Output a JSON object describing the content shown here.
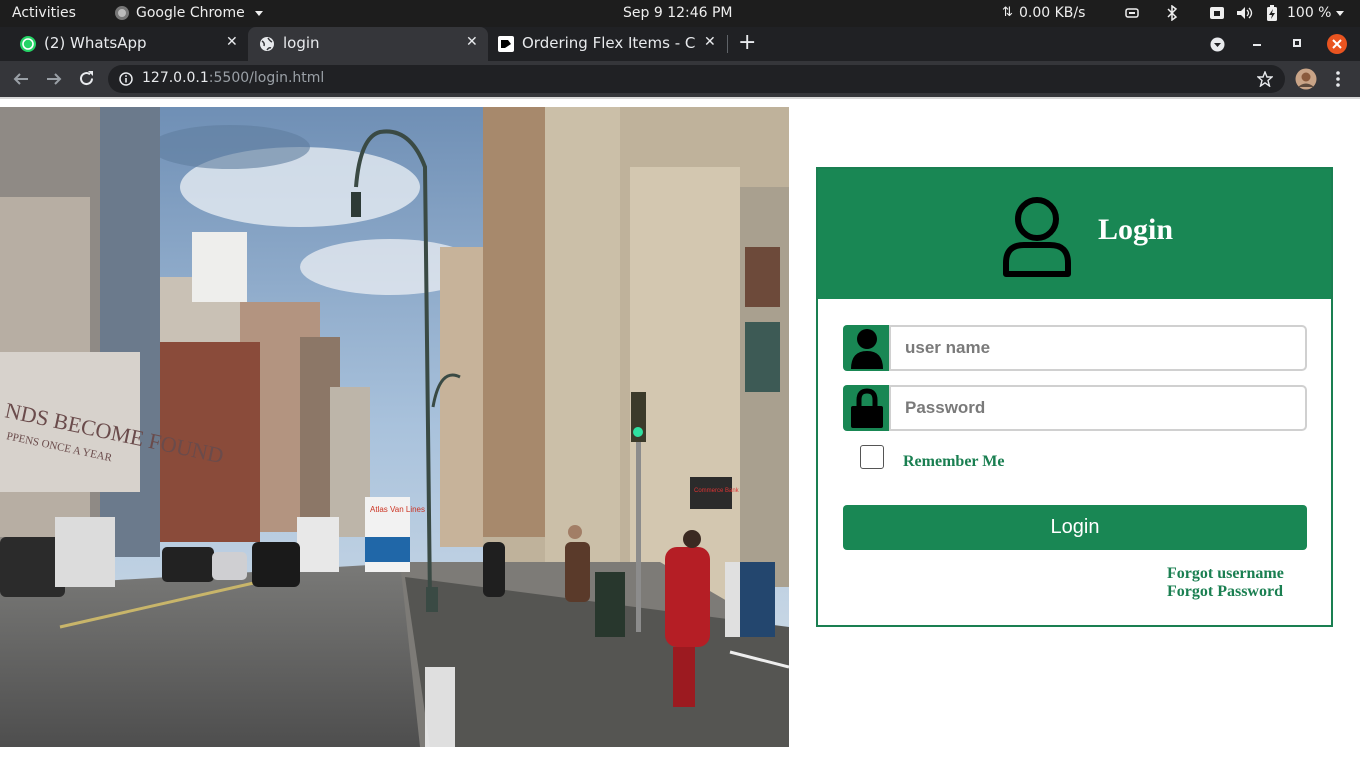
{
  "system_bar": {
    "activities": "Activities",
    "app_name": "Google Chrome",
    "clock": "Sep 9  12:46 PM",
    "network_speed": "0.00 KB/s",
    "battery": "100 %"
  },
  "browser": {
    "tabs": [
      {
        "title": "(2) WhatsApp",
        "icon": "whatsapp-icon"
      },
      {
        "title": "login",
        "icon": "globe-icon",
        "active": true
      },
      {
        "title": "Ordering Flex Items - C",
        "icon": "site-icon"
      }
    ],
    "url_host": "127.0.0.1",
    "url_rest": ":5500/login.html"
  },
  "login_form": {
    "title": "Login",
    "username_placeholder": "user name",
    "password_placeholder": "Password",
    "remember_label": "Remember Me",
    "submit_label": "Login",
    "forgot_username": "Forgot username",
    "forgot_password": "Forgot Password"
  },
  "photo_signs": {
    "banner": "NDS BECOME FOUND",
    "banner_sub": "PPENS ONCE A YEAR",
    "truck": "Atlas Van Lines",
    "bank": "Commerce Bank"
  },
  "colors": {
    "brand_green": "#198754",
    "text_green": "#1a7f51",
    "chrome_dark": "#202124",
    "close_red": "#e95420"
  }
}
